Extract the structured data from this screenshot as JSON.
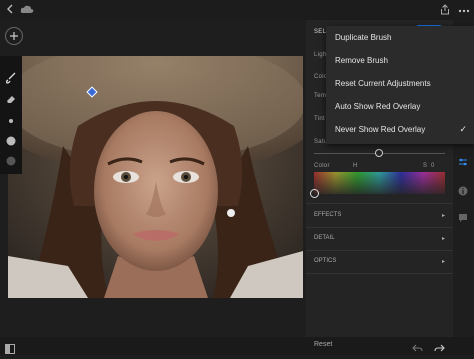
{
  "topbar": {
    "back_icon": "back-arrow-icon",
    "cloud_icon": "cloud-sync-icon",
    "share_icon": "share-icon",
    "more_icon": "more-options-icon"
  },
  "canvas": {
    "add_icon": "plus-icon",
    "pin_color": "#3b6bd6"
  },
  "tools": [
    "brush-icon",
    "eraser-icon",
    "brush-size-small-icon",
    "brush-size-large-icon",
    "feather-icon"
  ],
  "panel": {
    "header_fragment": "SELE",
    "labels": [
      "Ligh",
      "Colo",
      "Tem",
      "Tint",
      "Satu"
    ],
    "color_row": {
      "label": "Color",
      "h_label": "H",
      "s_label": "S",
      "s_value": "0"
    },
    "sections": [
      {
        "label": "EFFECTS"
      },
      {
        "label": "DETAIL"
      },
      {
        "label": "OPTICS"
      }
    ],
    "reset_label": "Reset"
  },
  "menu": {
    "items": [
      {
        "label": "Duplicate Brush",
        "checked": false
      },
      {
        "label": "Remove Brush",
        "checked": false
      },
      {
        "label": "Reset Current Adjustments",
        "checked": false
      },
      {
        "label": "Auto Show Red Overlay",
        "checked": false
      },
      {
        "label": "Never Show Red Overlay",
        "checked": true
      }
    ],
    "check_glyph": "✓"
  },
  "colors": {
    "accent": "#1473e6",
    "panel_bg": "#242424",
    "menu_bg": "#2b2b2b"
  }
}
